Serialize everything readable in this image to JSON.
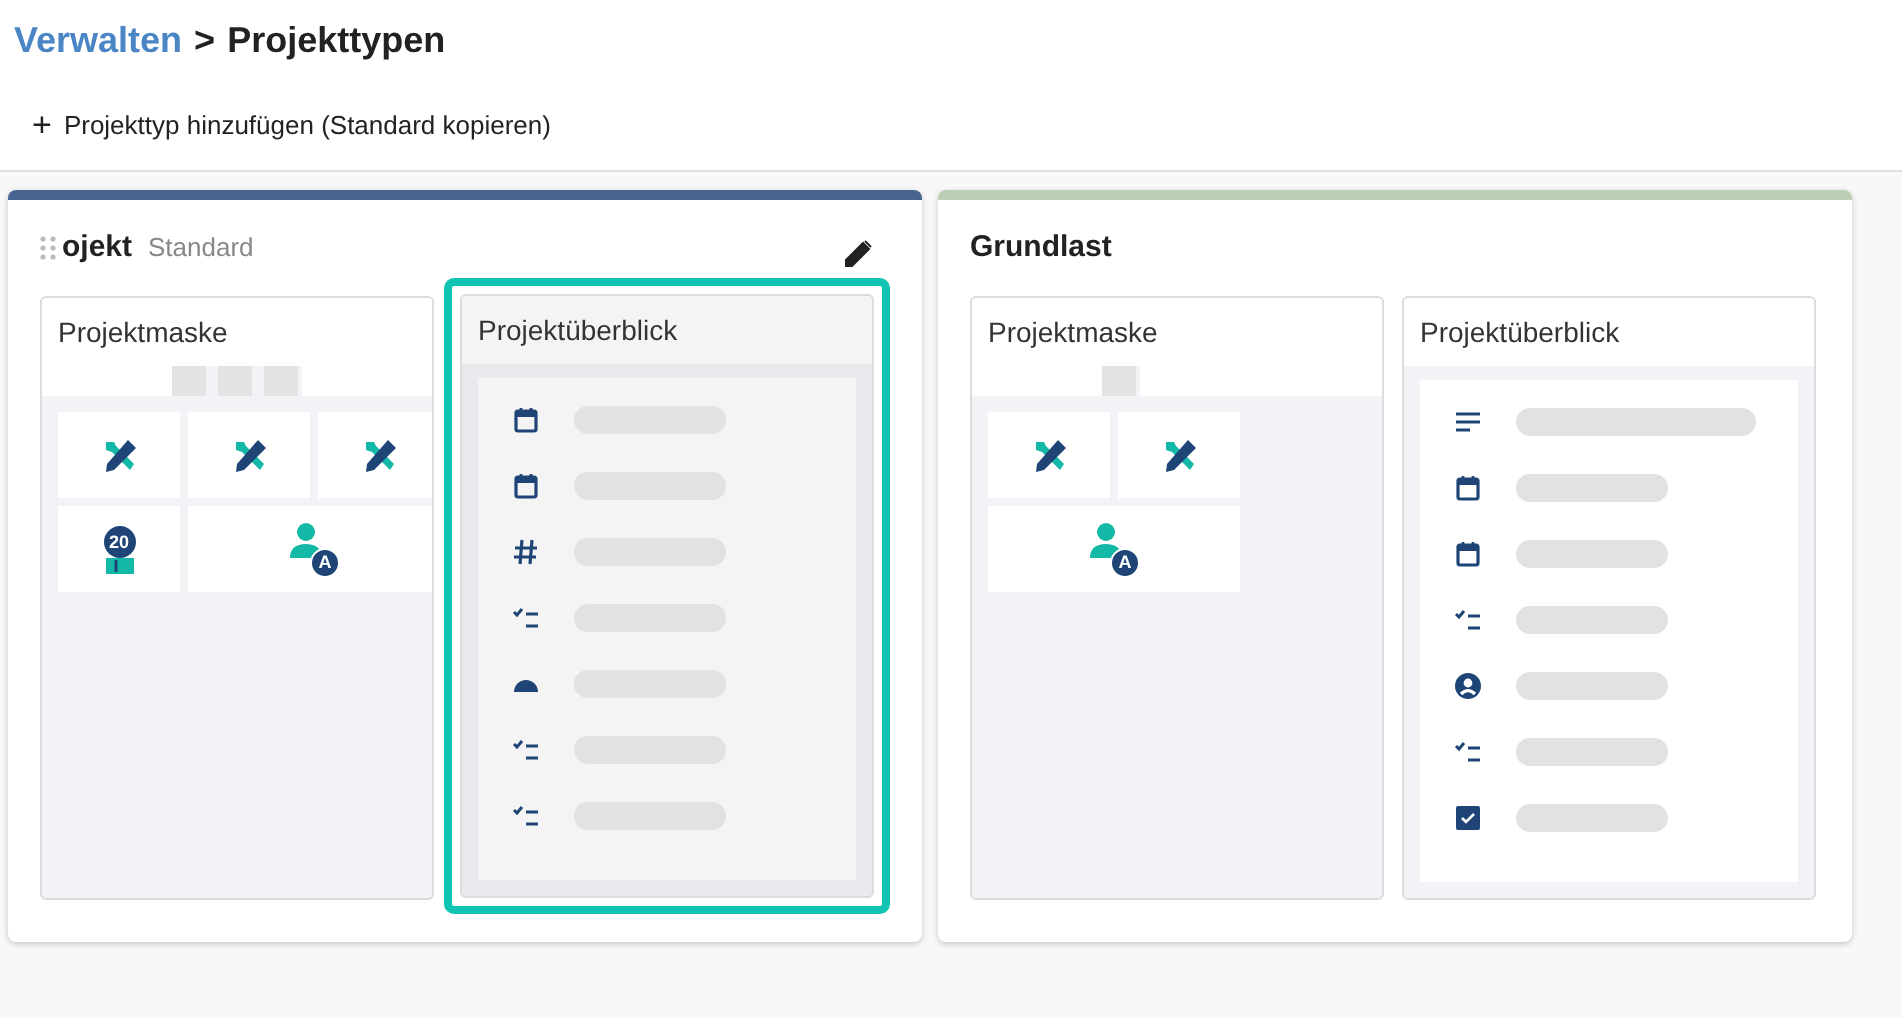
{
  "breadcrumb": {
    "parent": "Verwalten",
    "separator": ">",
    "current": "Projekttypen"
  },
  "toolbar": {
    "add_icon": "+",
    "add_label": "Projekttyp hinzufügen (Standard kopieren)"
  },
  "project_types": [
    {
      "title": "ojekt",
      "badge": "Standard",
      "color": "#4a6491",
      "draggable": true,
      "editable": true,
      "mask": {
        "title": "Projektmaske",
        "tab_stubs": [
          {
            "kind": "stub"
          },
          {
            "kind": "stub"
          },
          {
            "kind": "stub"
          }
        ],
        "tiles": [
          {
            "kind": "tools",
            "wide": false
          },
          {
            "kind": "tools",
            "wide": false
          },
          {
            "kind": "tools",
            "wide": false
          },
          {
            "kind": "calendar",
            "badge": "20",
            "wide": false
          },
          {
            "kind": "person",
            "badge": "A",
            "wide": true
          }
        ]
      },
      "overview": {
        "title": "Projektüberblick",
        "selected": true,
        "fields": [
          {
            "kind": "calendar",
            "wide": false
          },
          {
            "kind": "calendar",
            "wide": false
          },
          {
            "kind": "number",
            "wide": false
          },
          {
            "kind": "checklist",
            "wide": false
          },
          {
            "kind": "gauge",
            "wide": false
          },
          {
            "kind": "checklist",
            "wide": false
          },
          {
            "kind": "checklist",
            "wide": false
          }
        ]
      }
    },
    {
      "title": "Grundlast",
      "color": "#bacfb4",
      "draggable": false,
      "editable": false,
      "mask": {
        "title": "Projektmaske",
        "tab_stubs": [
          {
            "kind": "stub"
          }
        ],
        "tiles": [
          {
            "kind": "tools",
            "wide": false
          },
          {
            "kind": "tools",
            "wide": false
          },
          {
            "kind": "person",
            "badge": "A",
            "wide": true
          }
        ]
      },
      "overview": {
        "title": "Projektüberblick",
        "selected": false,
        "fields": [
          {
            "kind": "text",
            "wide": true
          },
          {
            "kind": "calendar",
            "wide": false
          },
          {
            "kind": "calendar",
            "wide": false
          },
          {
            "kind": "checklist",
            "wide": false
          },
          {
            "kind": "person",
            "wide": false
          },
          {
            "kind": "checklist",
            "wide": false
          },
          {
            "kind": "checkbox",
            "wide": false
          }
        ]
      }
    }
  ]
}
